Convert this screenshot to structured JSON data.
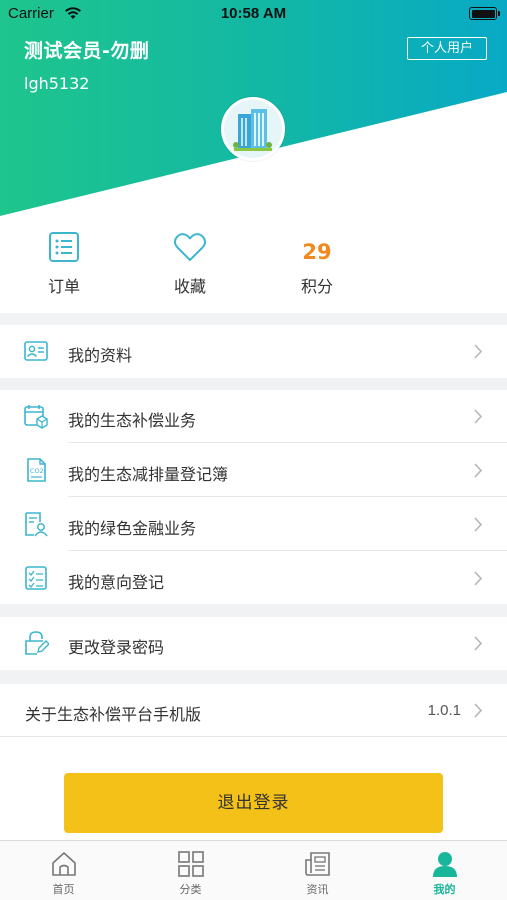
{
  "status_bar": {
    "carrier": "Carrier",
    "time": "10:58 AM"
  },
  "profile": {
    "name": "测试会员-勿删",
    "user_id": "lgh5132",
    "user_type": "个人用户"
  },
  "stats": {
    "orders_label": "订单",
    "favorites_label": "收藏",
    "points_value": "29",
    "points_label": "积分"
  },
  "menu": {
    "my_profile": "我的资料",
    "eco_compensation": "我的生态补偿业务",
    "emission_register": "我的生态减排量登记簿",
    "green_finance": "我的绿色金融业务",
    "intent_register": "我的意向登记",
    "change_password": "更改登录密码",
    "about": "关于生态补偿平台手机版",
    "version": "1.0.1"
  },
  "logout_label": "退出登录",
  "tabbar": {
    "home": "首页",
    "category": "分类",
    "news": "资讯",
    "mine": "我的"
  },
  "colors": {
    "header_gradient_start": "#1ec58c",
    "header_gradient_end": "#08a9c6",
    "accent_teal": "#18b69a",
    "icon_teal": "#3cb6cf",
    "points_orange": "#f08a1c",
    "logout_yellow": "#f3c118"
  },
  "icons": {
    "orders": "list-icon",
    "favorites": "heart-icon",
    "my_profile": "id-card-icon",
    "eco_compensation": "calendar-box-icon",
    "emission_register": "co2-document-icon",
    "green_finance": "person-document-icon",
    "intent_register": "checklist-icon",
    "change_password": "lock-edit-icon",
    "home": "home-icon",
    "category": "grid-icon",
    "news": "newspaper-icon",
    "mine": "person-icon"
  }
}
